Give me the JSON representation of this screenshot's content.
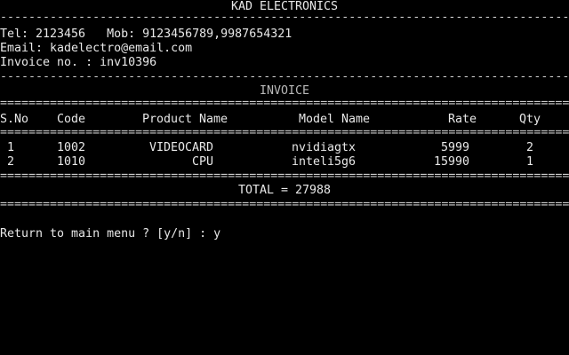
{
  "shop": {
    "name": "KAD ELECTRONICS",
    "tel_line": "Tel: 2123456   Mob: 9123456789,9987654321",
    "email_line": "Email: kadelectro@email.com",
    "invoice_line": "Invoice no. : inv10396"
  },
  "rules": {
    "dash": "--------------------------------------------------------------------------------------------------------------",
    "equals": "=============================================================================================================="
  },
  "invoice": {
    "heading": "INVOICE",
    "headers": {
      "sno": "S.No",
      "code": "Code",
      "product": "Product Name",
      "model": "Model Name",
      "rate": "Rate",
      "qty": "Qty"
    },
    "rows": [
      {
        "sno": "1",
        "code": "1002",
        "product": "VIDEOCARD",
        "model": "nvidiagtx",
        "rate": "5999",
        "qty": "2"
      },
      {
        "sno": "2",
        "code": "1010",
        "product": "CPU",
        "model": "inteli5g6",
        "rate": "15990",
        "qty": "1"
      }
    ],
    "total_line": "TOTAL = 27988"
  },
  "prompt": {
    "text": "Return to main menu ? [y/n] : y"
  }
}
